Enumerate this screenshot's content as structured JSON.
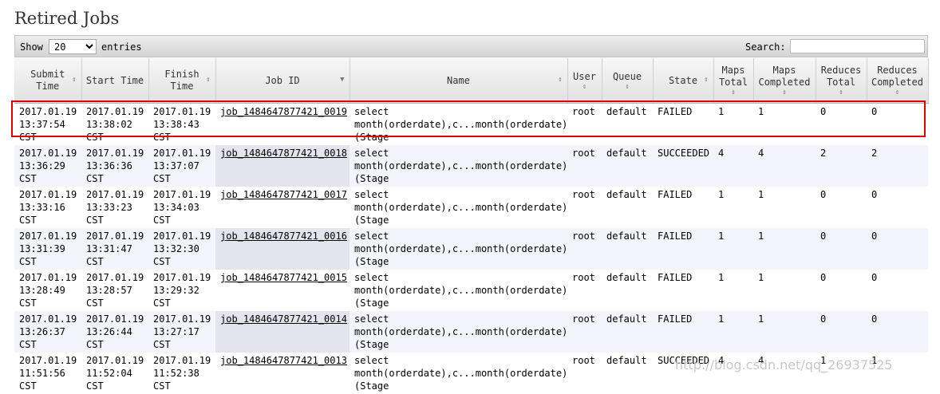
{
  "page": {
    "title": "Retired Jobs"
  },
  "toolbar": {
    "show_label": "Show",
    "entries_value": "20",
    "entries_label": "entries",
    "search_label": "Search:",
    "search_value": ""
  },
  "columns": [
    "Submit Time",
    "Start Time",
    "Finish Time",
    "Job ID",
    "Name",
    "User",
    "Queue",
    "State",
    "Maps Total",
    "Maps Completed",
    "Reduces Total",
    "Reduces Completed"
  ],
  "rows": [
    [
      "2017.01.19 13:37:54 CST",
      "2017.01.19 13:38:02 CST",
      "2017.01.19 13:38:43 CST",
      "job_1484647877421_0019",
      "select month(orderdate),c...month(orderdate) (Stage",
      "root",
      "default",
      "FAILED",
      "1",
      "1",
      "0",
      "0"
    ],
    [
      "2017.01.19 13:36:29 CST",
      "2017.01.19 13:36:36 CST",
      "2017.01.19 13:37:07 CST",
      "job_1484647877421_0018",
      "select month(orderdate),c...month(orderdate) (Stage",
      "root",
      "default",
      "SUCCEEDED",
      "4",
      "4",
      "2",
      "2"
    ],
    [
      "2017.01.19 13:33:16 CST",
      "2017.01.19 13:33:23 CST",
      "2017.01.19 13:34:03 CST",
      "job_1484647877421_0017",
      "select month(orderdate),c...month(orderdate) (Stage",
      "root",
      "default",
      "FAILED",
      "1",
      "1",
      "0",
      "0"
    ],
    [
      "2017.01.19 13:31:39 CST",
      "2017.01.19 13:31:47 CST",
      "2017.01.19 13:32:30 CST",
      "job_1484647877421_0016",
      "select month(orderdate),c...month(orderdate) (Stage",
      "root",
      "default",
      "FAILED",
      "1",
      "1",
      "0",
      "0"
    ],
    [
      "2017.01.19 13:28:49 CST",
      "2017.01.19 13:28:57 CST",
      "2017.01.19 13:29:32 CST",
      "job_1484647877421_0015",
      "select month(orderdate),c...month(orderdate) (Stage",
      "root",
      "default",
      "FAILED",
      "1",
      "1",
      "0",
      "0"
    ],
    [
      "2017.01.19 13:26:37 CST",
      "2017.01.19 13:26:44 CST",
      "2017.01.19 13:27:17 CST",
      "job_1484647877421_0014",
      "select month(orderdate),c...month(orderdate) (Stage",
      "root",
      "default",
      "FAILED",
      "1",
      "1",
      "0",
      "0"
    ],
    [
      "2017.01.19 11:51:56 CST",
      "2017.01.19 11:52:04 CST",
      "2017.01.19 11:52:38 CST",
      "job_1484647877421_0013",
      "select month(orderdate),c...month(orderdate) (Stage",
      "root",
      "default",
      "SUCCEEDED",
      "4",
      "4",
      "1",
      "1"
    ]
  ],
  "watermark": "http://blog.csdn.net/qq_26937525",
  "colors": {
    "highlight": "#e00000",
    "even_row": "#f4f4fc"
  }
}
